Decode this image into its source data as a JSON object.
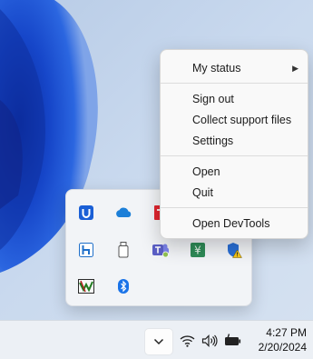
{
  "context_menu": {
    "items": [
      {
        "label": "My status",
        "has_submenu": true
      },
      {
        "label": "Sign out"
      },
      {
        "label": "Collect support files"
      },
      {
        "label": "Settings"
      },
      {
        "label": "Open"
      },
      {
        "label": "Quit"
      },
      {
        "label": "Open DevTools"
      }
    ],
    "submenu_arrow": "▶"
  },
  "tray_flyout": {
    "icons": [
      {
        "name": "ugreen-app-icon",
        "color": "#1a5fd6"
      },
      {
        "name": "onedrive-icon",
        "color": "#1c7fd8"
      },
      {
        "name": "red-app-icon",
        "color": "#e0252f"
      },
      {
        "name": "hamachi-h-icon",
        "color": "#1f6fc9"
      },
      {
        "name": "usb-drive-icon",
        "color": "#555555"
      },
      {
        "name": "teams-icon",
        "color": "#5b5fc7"
      },
      {
        "name": "yuan-app-icon",
        "color": "#2e8b57"
      },
      {
        "name": "windows-security-warning-icon",
        "color": "#2a6fd6"
      },
      {
        "name": "speccy-app-icon",
        "color": "#2a2a2a"
      },
      {
        "name": "bluetooth-icon",
        "color": "#1a73e8"
      }
    ]
  },
  "taskbar": {
    "overflow_icon": "chevron-up-icon",
    "wifi_icon": "wifi-icon",
    "volume_icon": "speaker-icon",
    "battery_icon": "battery-charging-icon",
    "time": "4:27 PM",
    "date": "2/20/2024"
  }
}
